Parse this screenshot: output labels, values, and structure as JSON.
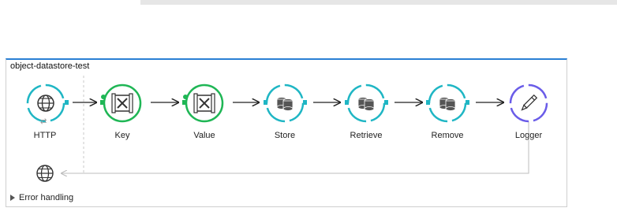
{
  "flow": {
    "title": "object-datastore-test",
    "nodes": [
      {
        "label": "HTTP",
        "icon": "globe-icon",
        "ring_color": "#1fb6c4"
      },
      {
        "label": "Key",
        "icon": "transformer-icon",
        "ring_color": "#1fb655"
      },
      {
        "label": "Value",
        "icon": "transformer-icon",
        "ring_color": "#1fb655"
      },
      {
        "label": "Store",
        "icon": "database-icon",
        "ring_color": "#1fb6c4"
      },
      {
        "label": "Retrieve",
        "icon": "database-icon",
        "ring_color": "#1fb6c4"
      },
      {
        "label": "Remove",
        "icon": "database-icon",
        "ring_color": "#1fb6c4"
      },
      {
        "label": "Logger",
        "icon": "pencil-icon",
        "ring_color": "#6a5ce8"
      }
    ],
    "response_icon": "globe-icon",
    "error_handling_label": "Error handling"
  }
}
